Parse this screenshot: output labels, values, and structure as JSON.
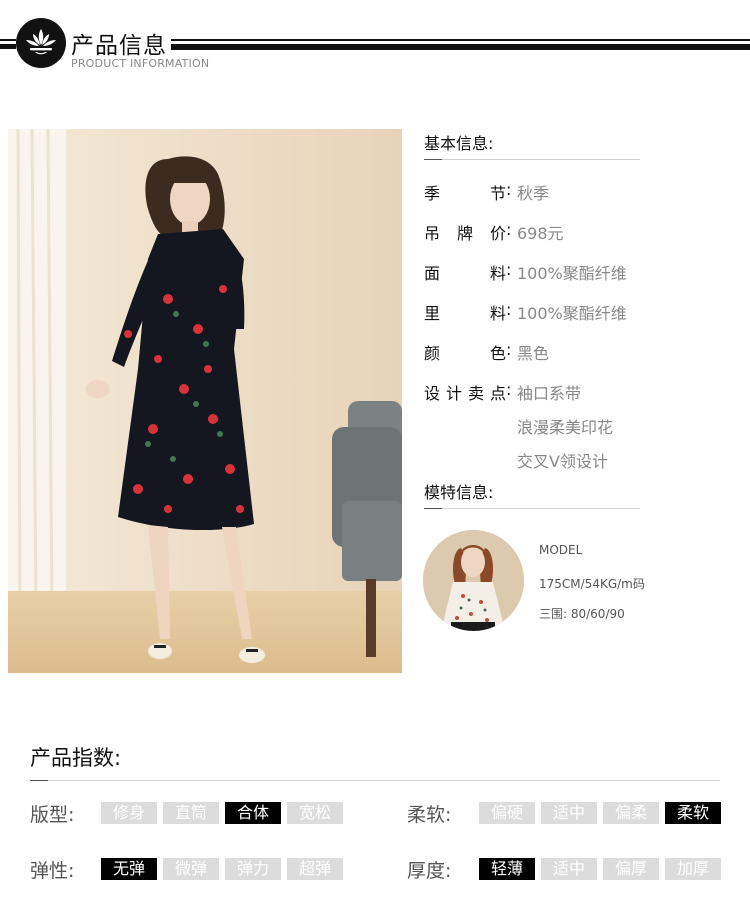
{
  "header": {
    "title": "产品信息",
    "subtitle": "PRODUCT INFORMATION",
    "logo_icon": "lotus-logo-icon"
  },
  "basic_info": {
    "title": "基本信息:",
    "rows": [
      {
        "label": "季节",
        "value": "秋季"
      },
      {
        "label": "吊牌价",
        "value": "698元"
      },
      {
        "label": "面料",
        "value": "100%聚酯纤维"
      },
      {
        "label": "里料",
        "value": "100%聚酯纤维"
      },
      {
        "label": "颜色",
        "value": "黑色"
      },
      {
        "label": "设计卖点",
        "value": "袖口系带",
        "extra": [
          "浪漫柔美印花",
          "交叉V领设计"
        ]
      }
    ]
  },
  "model_info": {
    "title": "模特信息:",
    "lines": [
      "MODEL",
      "175CM/54KG/m码",
      "三围: 80/60/90"
    ]
  },
  "product_index": {
    "title": "产品指数:",
    "groups": [
      {
        "label": "版型:",
        "options": [
          "修身",
          "直筒",
          "合体",
          "宽松"
        ],
        "selected": 2
      },
      {
        "label": "柔软:",
        "options": [
          "偏硬",
          "适中",
          "偏柔",
          "柔软"
        ],
        "selected": 3
      },
      {
        "label": "弹性:",
        "options": [
          "无弹",
          "微弹",
          "弹力",
          "超弹"
        ],
        "selected": 0
      },
      {
        "label": "厚度:",
        "options": [
          "轻薄",
          "适中",
          "偏厚",
          "加厚"
        ],
        "selected": 0
      }
    ]
  },
  "colors": {
    "tag_inactive": "#dcdcdc",
    "tag_active": "#000000",
    "label_gray": "#888888"
  }
}
